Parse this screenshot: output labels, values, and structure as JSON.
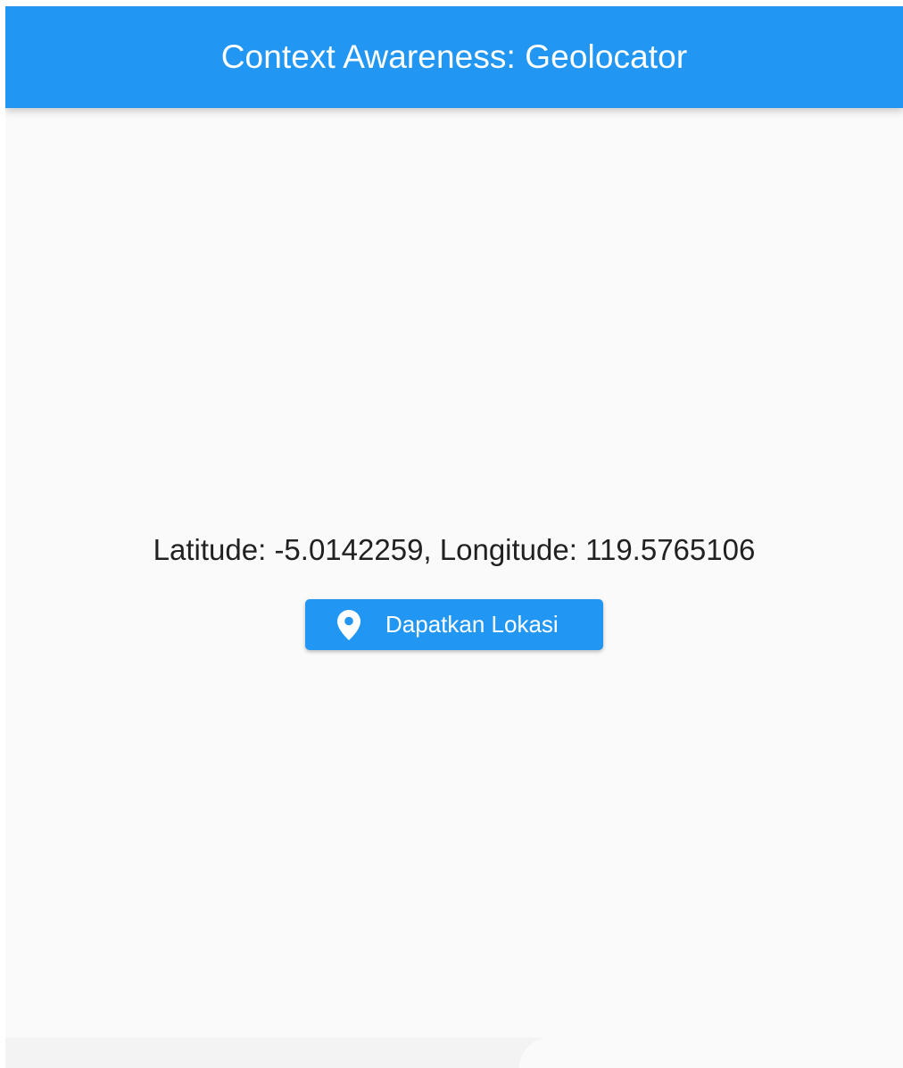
{
  "appbar": {
    "title": "Context Awareness: Geolocator"
  },
  "main": {
    "location_text": "Latitude: -5.0142259, Longitude: 119.5765106",
    "get_location_button": {
      "label": "Dapatkan Lokasi",
      "icon": "location-pin-icon"
    }
  },
  "colors": {
    "primary": "#2196f3",
    "background": "#fafafa",
    "text": "#212121"
  }
}
